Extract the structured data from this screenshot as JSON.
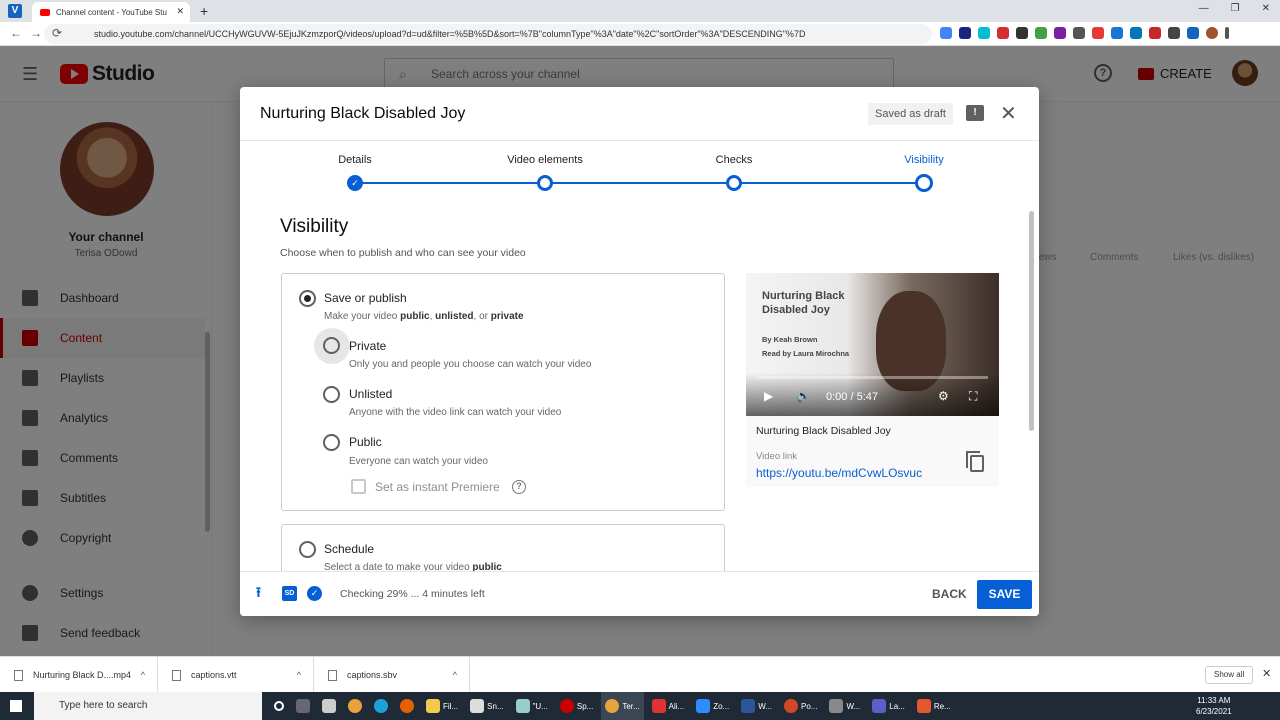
{
  "browser": {
    "tab_title": "Channel content - YouTube Stu",
    "url": "studio.youtube.com/channel/UCCHyWGUVW-5EjuJKzmzporQ/videos/upload?d=ud&filter=%5B%5D&sort=%7B\"columnType\"%3A\"date\"%2C\"sortOrder\"%3A\"DESCENDING\"%7D"
  },
  "studio": {
    "logo_text": "Studio",
    "search_placeholder": "Search across your channel",
    "create_label": "CREATE",
    "channel_label": "Your channel",
    "channel_name": "Terisa ODowd",
    "nav": [
      {
        "label": "Dashboard"
      },
      {
        "label": "Content"
      },
      {
        "label": "Playlists"
      },
      {
        "label": "Analytics"
      },
      {
        "label": "Comments"
      },
      {
        "label": "Subtitles"
      },
      {
        "label": "Copyright"
      },
      {
        "label": "Settings"
      },
      {
        "label": "Send feedback"
      }
    ],
    "bg_columns": [
      "Views",
      "Comments",
      "Likes (vs. dislikes)"
    ]
  },
  "dialog": {
    "title": "Nurturing Black Disabled Joy",
    "draft_badge": "Saved as draft",
    "steps": [
      "Details",
      "Video elements",
      "Checks",
      "Visibility"
    ],
    "section_title": "Visibility",
    "section_subtitle": "Choose when to publish and who can see your video",
    "save_publish": {
      "label": "Save or publish",
      "desc_prefix": "Make your video ",
      "desc_b1": "public",
      "desc_sep1": ", ",
      "desc_b2": "unlisted",
      "desc_sep2": ", or ",
      "desc_b3": "private"
    },
    "options": [
      {
        "label": "Private",
        "desc": "Only you and people you choose can watch your video"
      },
      {
        "label": "Unlisted",
        "desc": "Anyone with the video link can watch your video"
      },
      {
        "label": "Public",
        "desc": "Everyone can watch your video"
      }
    ],
    "premiere_label": "Set as instant Premiere",
    "schedule": {
      "label": "Schedule",
      "desc_prefix": "Select a date to make your video ",
      "desc_bold": "public"
    },
    "preview": {
      "thumb_title": "Nurturing Black Disabled Joy",
      "thumb_by": "By Keah Brown",
      "thumb_read": "Read by Laura Mirochna",
      "time": "0:00 / 5:47",
      "video_title": "Nurturing Black Disabled Joy",
      "link_label": "Video link",
      "link": "https://youtu.be/mdCvwLOsvuc"
    },
    "footer": {
      "sd_label": "SD",
      "status": "Checking 29% ... 4 minutes left",
      "back_label": "BACK",
      "save_label": "SAVE"
    }
  },
  "downloads": {
    "items": [
      "Nurturing Black D....mp4",
      "captions.vtt",
      "captions.sbv"
    ],
    "show_all": "Show all"
  },
  "taskbar": {
    "search_placeholder": "Type here to search",
    "apps": [
      "Fil...",
      "Sn...",
      "\"U...",
      "Sp...",
      "Ter...",
      "Ali...",
      "Zo...",
      "W...",
      "Po...",
      "W...",
      "La...",
      "Re..."
    ],
    "time": "11:33 AM",
    "date": "6/23/2021"
  }
}
